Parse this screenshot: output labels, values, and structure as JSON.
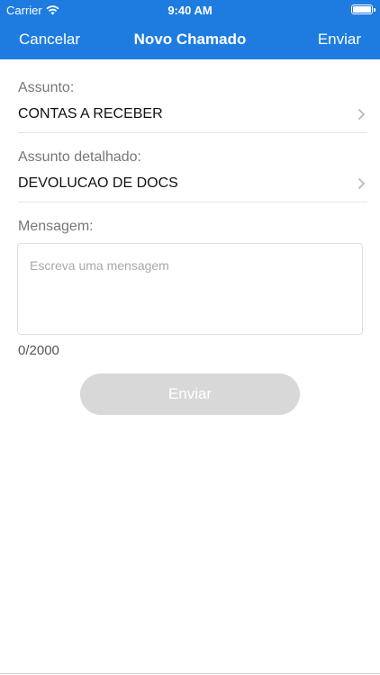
{
  "status_bar": {
    "carrier": "Carrier",
    "time": "9:40 AM",
    "wifi_icon": "wifi-icon",
    "battery_icon": "battery-icon",
    "battery_level": 1.0
  },
  "nav": {
    "cancel_label": "Cancelar",
    "title": "Novo Chamado",
    "send_label": "Enviar"
  },
  "form": {
    "subject": {
      "label": "Assunto:",
      "value": "CONTAS A RECEBER"
    },
    "detailed_subject": {
      "label": "Assunto detalhado:",
      "value": "DEVOLUCAO DE DOCS"
    },
    "message": {
      "label": "Mensagem:",
      "placeholder": "Escreva uma mensagem",
      "value": "",
      "counter": "0/2000"
    },
    "submit_label": "Enviar"
  },
  "colors": {
    "brand": "#1E7CE0",
    "disabled_button": "#D8D8D8",
    "label": "#777777"
  }
}
